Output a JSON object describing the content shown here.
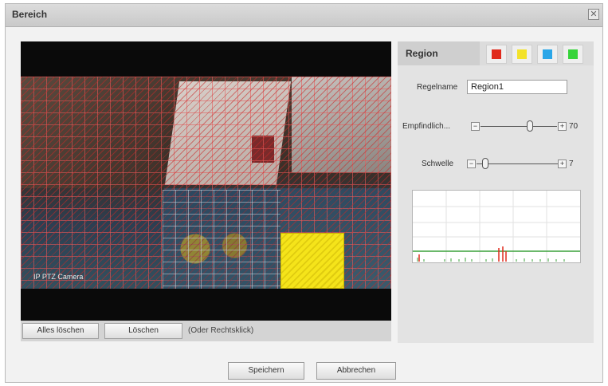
{
  "dialog": {
    "title": "Bereich",
    "close_glyph": "✕"
  },
  "video": {
    "camera_label": "IP PTZ Camera"
  },
  "toolbar": {
    "clear_all_label": "Alles löschen",
    "delete_label": "Löschen",
    "hint": "(Oder Rechtsklick)"
  },
  "panel": {
    "tab_label": "Region",
    "swatches": [
      {
        "name": "red",
        "color": "#e02a1c"
      },
      {
        "name": "yellow",
        "color": "#f3e22a"
      },
      {
        "name": "blue",
        "color": "#2aa6e8"
      },
      {
        "name": "green",
        "color": "#36d43a"
      }
    ],
    "rule_name_label": "Regelname",
    "rule_name_value": "Region1",
    "sensitivity_label": "Empfindlich...",
    "sensitivity_value": "70",
    "threshold_label": "Schwelle",
    "threshold_value": "7",
    "minus_glyph": "−",
    "plus_glyph": "+"
  },
  "footer": {
    "save_label": "Speichern",
    "cancel_label": "Abbrechen"
  },
  "colors": {
    "grid_overlay": "#e65a5a",
    "threshold_line": "#3aa03a",
    "spike_color": "#e02a1c"
  }
}
